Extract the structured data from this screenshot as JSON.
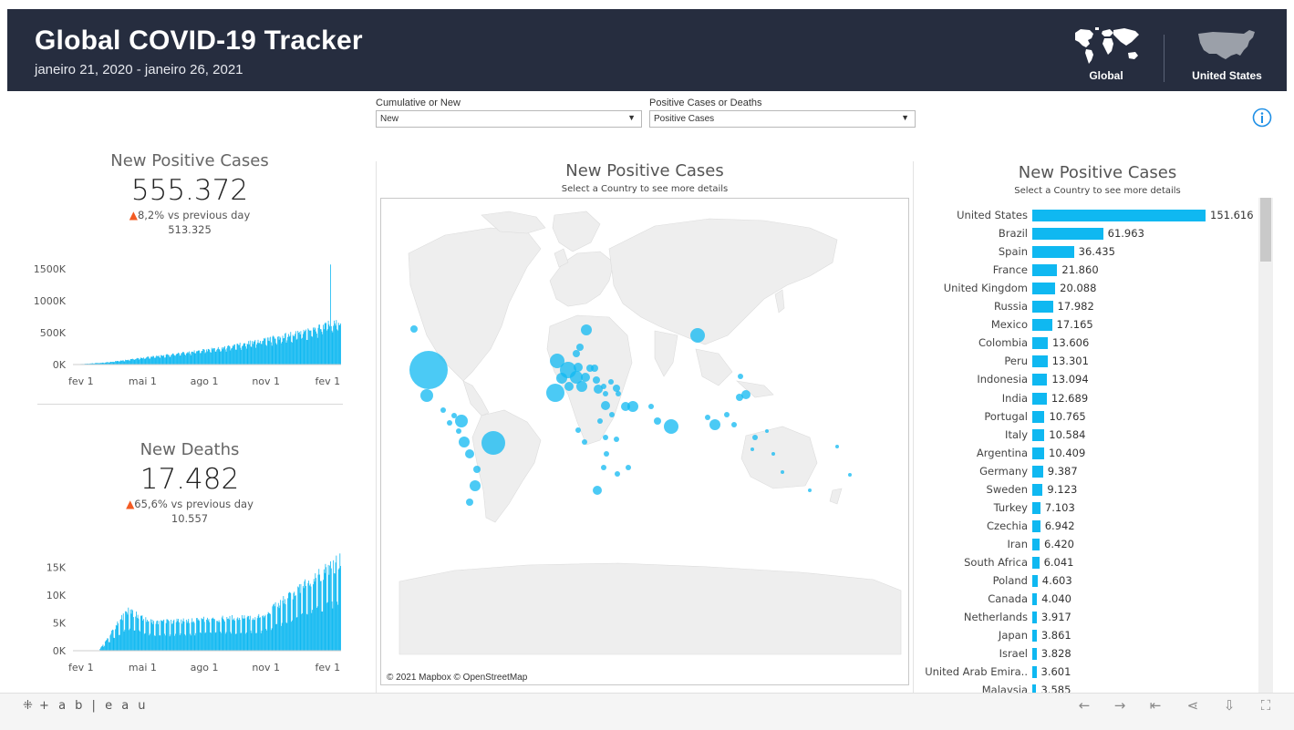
{
  "header": {
    "title": "Global COVID-19 Tracker",
    "subtitle": "janeiro 21, 2020 - janeiro 26, 2021",
    "nav_global": "Global",
    "nav_us": "United States"
  },
  "filters": {
    "cumulative_label": "Cumulative or New",
    "cumulative_value": "New",
    "metric_label": "Positive Cases or Deaths",
    "metric_value": "Positive Cases"
  },
  "kpi_cases": {
    "title": "New Positive Cases",
    "value": "555.372",
    "change": "8,2% vs previous day",
    "previous": "513.325"
  },
  "kpi_deaths": {
    "title": "New Deaths",
    "value": "17.482",
    "change": "65,6% vs previous day",
    "previous": "10.557"
  },
  "map_panel": {
    "title": "New Positive Cases",
    "subtitle": "Select a Country to see more details",
    "attribution": "© 2021 Mapbox  © OpenStreetMap"
  },
  "bar_panel": {
    "title": "New Positive Cases",
    "subtitle": "Select a Country to see more details"
  },
  "colors": {
    "header_bg": "#262d3f",
    "accent": "#0fb8f1",
    "up_arrow": "#f35b23"
  },
  "footer": {
    "logo": "+ a b | e a u"
  },
  "chart_data": [
    {
      "type": "bar",
      "title": "New Positive Cases",
      "subtitle": "Select a Country to see more details",
      "categories": [
        "United States",
        "Brazil",
        "Spain",
        "France",
        "United Kingdom",
        "Russia",
        "Mexico",
        "Colombia",
        "Peru",
        "Indonesia",
        "India",
        "Portugal",
        "Italy",
        "Argentina",
        "Germany",
        "Sweden",
        "Turkey",
        "Czechia",
        "Iran",
        "South Africa",
        "Poland",
        "Canada",
        "Netherlands",
        "Japan",
        "Israel",
        "United Arab Emira..",
        "Malaysia"
      ],
      "values": [
        151616,
        61963,
        36435,
        21860,
        20088,
        17982,
        17165,
        13606,
        13301,
        13094,
        12689,
        10765,
        10584,
        10409,
        9387,
        9123,
        7103,
        6942,
        6420,
        6041,
        4603,
        4040,
        3917,
        3861,
        3828,
        3601,
        3585
      ],
      "value_labels": [
        "151.616",
        "61.963",
        "36.435",
        "21.860",
        "20.088",
        "17.982",
        "17.165",
        "13.606",
        "13.301",
        "13.094",
        "12.689",
        "10.765",
        "10.584",
        "10.409",
        "9.387",
        "9.123",
        "7.103",
        "6.942",
        "6.420",
        "6.041",
        "4.603",
        "4.040",
        "3.917",
        "3.861",
        "3.828",
        "3.601",
        "3.585"
      ]
    },
    {
      "type": "bar",
      "title": "New Positive Cases",
      "x_ticks": [
        "fev 1",
        "mai 1",
        "ago 1",
        "nov 1",
        "fev 1"
      ],
      "y_ticks": [
        "0K",
        "500K",
        "1000K",
        "1500K"
      ],
      "ylim": [
        0,
        1600000
      ],
      "series_profile": [
        0,
        0,
        0,
        0,
        1,
        1,
        2,
        3,
        4,
        5,
        6,
        6,
        7,
        8,
        9,
        10,
        11,
        12,
        13,
        13,
        14,
        15,
        16,
        17,
        18,
        18,
        19,
        20,
        21,
        22,
        23,
        24,
        25,
        27,
        28,
        30,
        32,
        34,
        36,
        38,
        40,
        44,
        48,
        52,
        56,
        60,
        64,
        68,
        66,
        62,
        60,
        56,
        52,
        50,
        48,
        45,
        42,
        40,
        38,
        37,
        36,
        36,
        37,
        38,
        40,
        42,
        44,
        46,
        48,
        50,
        52,
        54,
        56,
        58,
        60,
        63,
        66,
        70,
        74,
        78,
        82,
        86,
        90,
        95,
        100,
        106,
        112,
        118,
        124,
        130,
        138,
        146,
        155,
        164,
        172,
        180,
        188,
        196,
        204,
        212,
        220,
        228,
        236,
        242,
        248,
        254,
        260,
        266,
        272,
        278,
        284,
        290,
        296,
        300,
        305,
        310,
        316,
        322,
        328,
        334,
        340,
        346,
        352,
        358,
        364,
        370,
        380,
        390,
        400,
        410,
        420,
        430,
        440,
        452,
        464,
        476,
        488,
        500,
        510,
        520,
        540,
        560,
        580,
        600,
        620,
        640,
        660,
        680,
        700,
        720,
        740,
        760,
        780,
        800,
        810,
        820,
        830,
        840,
        850,
        860,
        870,
        880,
        890,
        900,
        905,
        910,
        915,
        920,
        925,
        930,
        935,
        940,
        945,
        950,
        955,
        960,
        965,
        970,
        975,
        980,
        985,
        990,
        995,
        1000,
        1005,
        1010,
        1015,
        1020,
        1025,
        1030,
        1035,
        1040,
        1045,
        1050,
        1055,
        1060,
        1065,
        1070,
        1075,
        1080,
        1085,
        1090,
        1095,
        1100,
        1105,
        1110,
        1115,
        1120,
        1125,
        1130,
        1135,
        1140,
        1145,
        1150,
        1155,
        1160,
        1165,
        1170,
        1175,
        1180,
        1185,
        1190,
        1195,
        1200,
        1210,
        1220,
        1230,
        1240,
        1250,
        1260,
        1270,
        1280,
        1290,
        1300,
        1310,
        1320,
        1330,
        1340,
        1350,
        1360,
        1370,
        1380,
        1390,
        1400,
        1410,
        1420,
        1430,
        1440,
        1450,
        1460,
        1470,
        1480,
        1490,
        1500,
        1510,
        1520,
        1530,
        1540,
        1550,
        1560,
        1570,
        1580,
        1590,
        1600,
        1610,
        1620,
        1630,
        1640,
        1650,
        1660,
        1670,
        1680,
        1690,
        1700,
        1710,
        1720,
        1730,
        1740,
        1750
      ]
    },
    {
      "type": "bar",
      "title": "New Deaths",
      "x_ticks": [
        "fev 1",
        "mai 1",
        "ago 1",
        "nov 1",
        "fev 1"
      ],
      "y_ticks": [
        "0K",
        "5K",
        "10K",
        "15K"
      ],
      "ylim": [
        0,
        18000
      ]
    }
  ]
}
